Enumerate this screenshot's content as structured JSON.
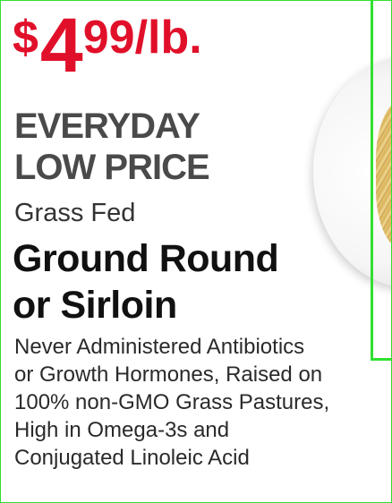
{
  "price": {
    "currency": "$",
    "dollars": "4",
    "cents": "99",
    "unit": "/lb."
  },
  "banner": {
    "line1": "EVERYDAY",
    "line2": "LOW PRICE"
  },
  "subtitle": "Grass Fed",
  "product": {
    "line1": "Ground Round",
    "line2": "or Sirloin"
  },
  "description": {
    "lines": [
      "Never Administered Antibiotics",
      "or Growth Hormones, Raised on",
      "100% non-GMO Grass Pastures,",
      "High in Omega-3s and",
      "Conjugated Linoleic Acid"
    ]
  },
  "colors": {
    "price": "#e1102a",
    "banner": "#4a4a4a",
    "frame": "#30e030"
  }
}
